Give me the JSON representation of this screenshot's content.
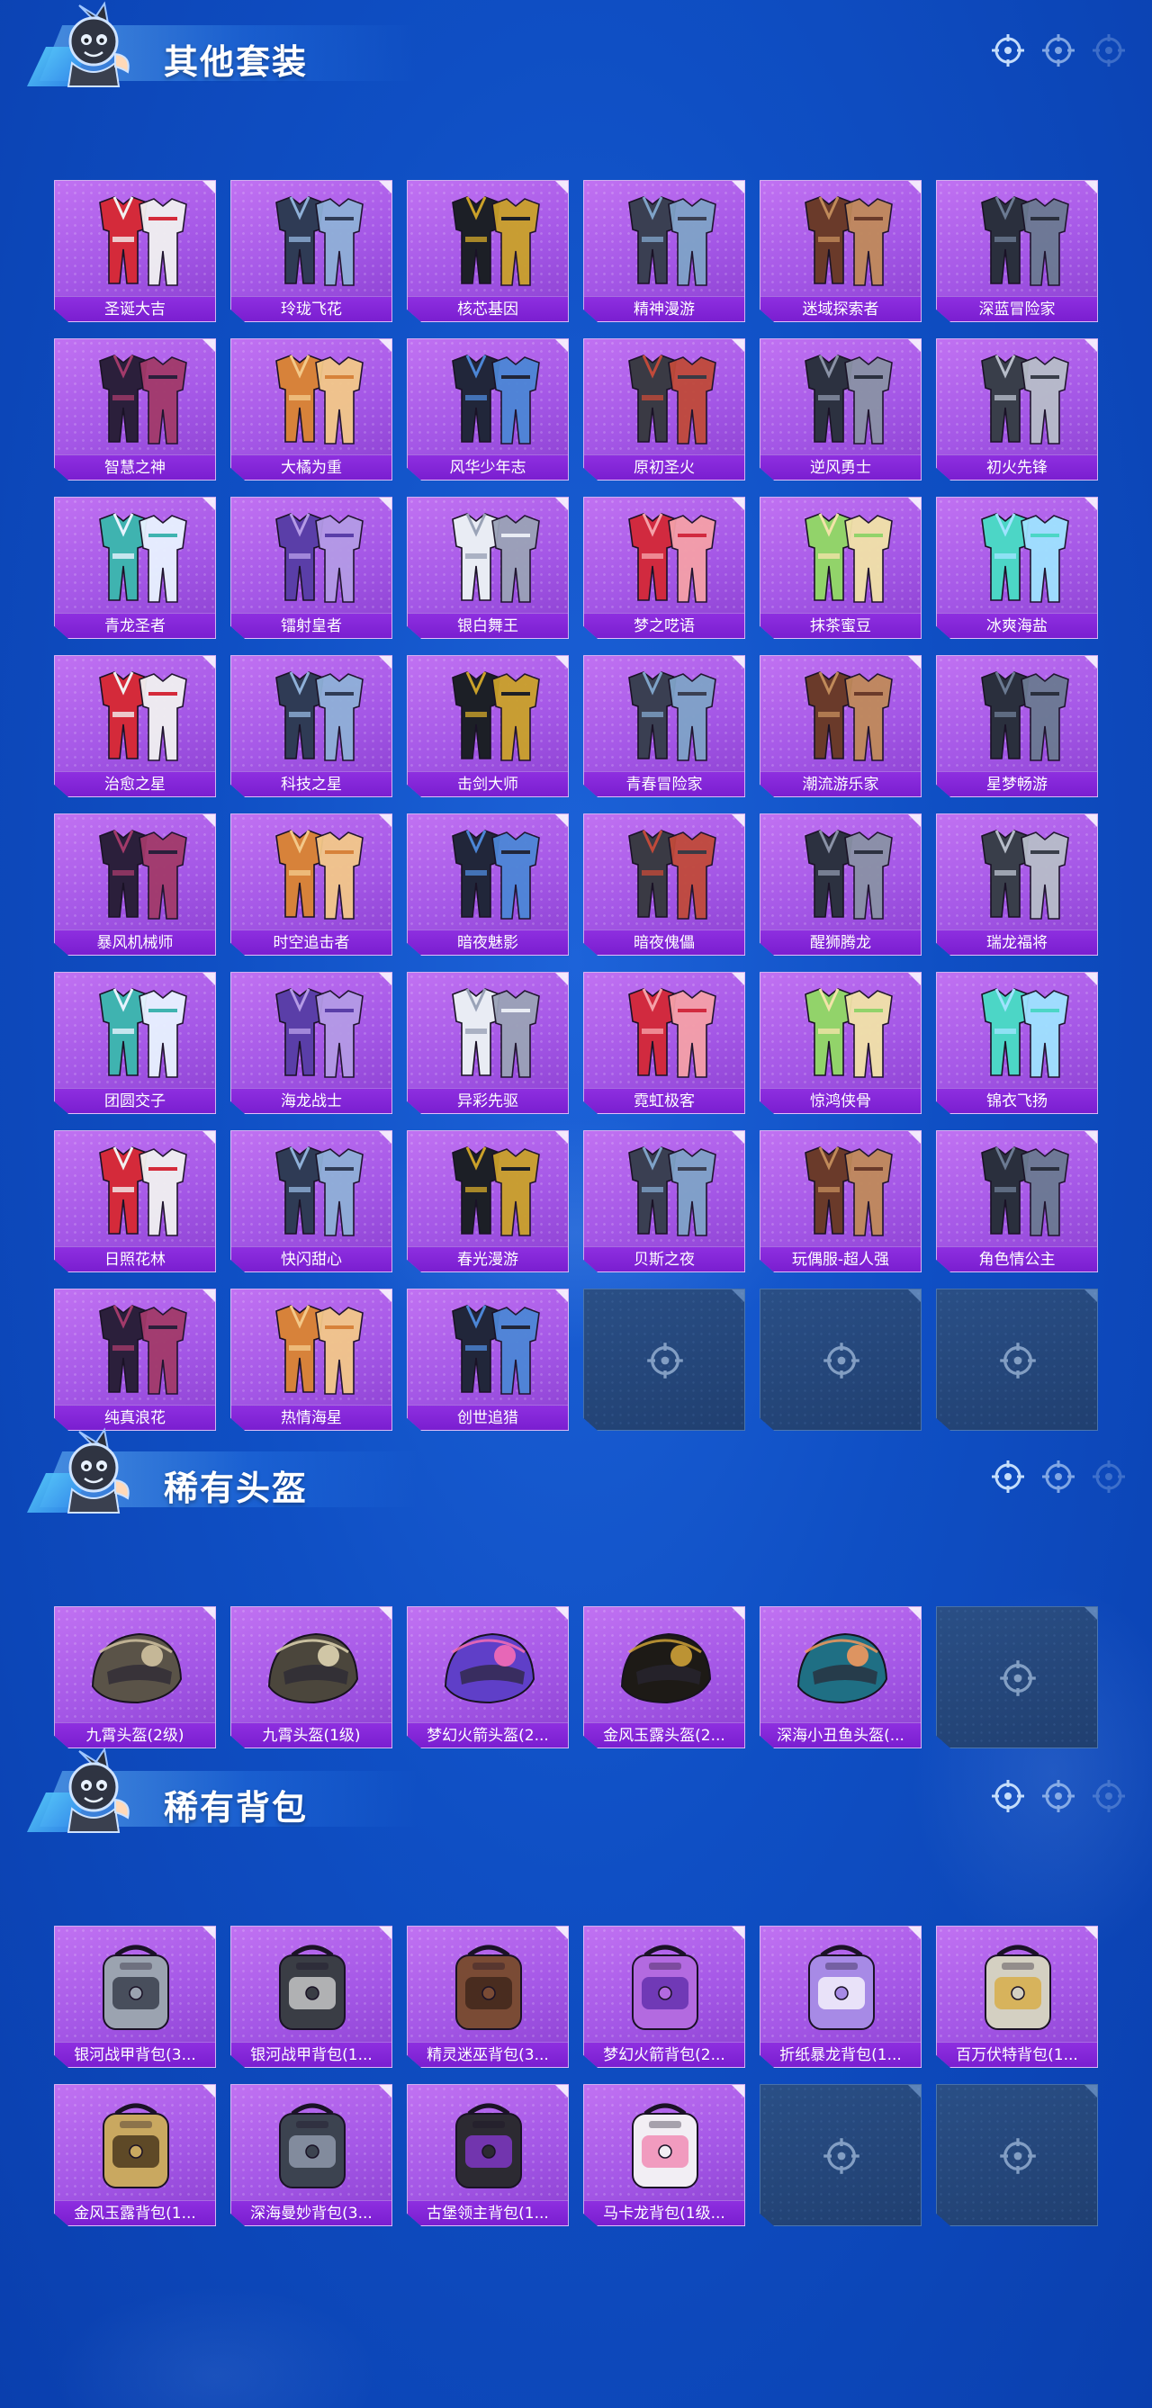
{
  "sections": [
    {
      "title": "其他套装",
      "items": [
        "圣诞大吉",
        "玲珑飞花",
        "核芯基因",
        "精神漫游",
        "迷域探索者",
        "深蓝冒险家",
        "智慧之神",
        "大橘为重",
        "风华少年志",
        "原初圣火",
        "逆风勇士",
        "初火先锋",
        "青龙圣者",
        "镭射皇者",
        "银白舞王",
        "梦之呓语",
        "抹茶蜜豆",
        "冰爽海盐",
        "治愈之星",
        "科技之星",
        "击剑大师",
        "青春冒险家",
        "潮流游乐家",
        "星梦畅游",
        "暴风机械师",
        "时空追击者",
        "暗夜魅影",
        "暗夜傀儡",
        "醒狮腾龙",
        "瑞龙福将",
        "团圆交子",
        "海龙战士",
        "异彩先驱",
        "霓虹极客",
        "惊鸿侠骨",
        "锦衣飞扬",
        "日照花林",
        "快闪甜心",
        "春光漫游",
        "贝斯之夜",
        "玩偶服-超人强",
        "角色情公主",
        "纯真浪花",
        "热情海星",
        "创世追猎"
      ],
      "empty_slots": 3
    },
    {
      "title": "稀有头盔",
      "items": [
        "九霄头盔(2级)",
        "九霄头盔(1级)",
        "梦幻火箭头盔(2...",
        "金风玉露头盔(2...",
        "深海小丑鱼头盔(..."
      ],
      "empty_slots": 1
    },
    {
      "title": "稀有背包",
      "items": [
        "银河战甲背包(3...",
        "银河战甲背包(1...",
        "精灵迷巫背包(3...",
        "梦幻火箭背包(2...",
        "折纸暴龙背包(1...",
        "百万伏特背包(1...",
        "金风玉露背包(1...",
        "深海曼妙背包(3...",
        "古堡领主背包(1...",
        "马卡龙背包(1级..."
      ],
      "empty_slots": 2
    }
  ],
  "icons": {
    "section_mascot": "mascot-icon",
    "header_decor": "crosshair-icon",
    "empty_slot": "crosshair-icon"
  },
  "colors": {
    "page_bg": "#0f4fc4",
    "card_bg": "#a457e6",
    "label_bg": "#7a1ed0",
    "empty_bg": "#203f70"
  }
}
